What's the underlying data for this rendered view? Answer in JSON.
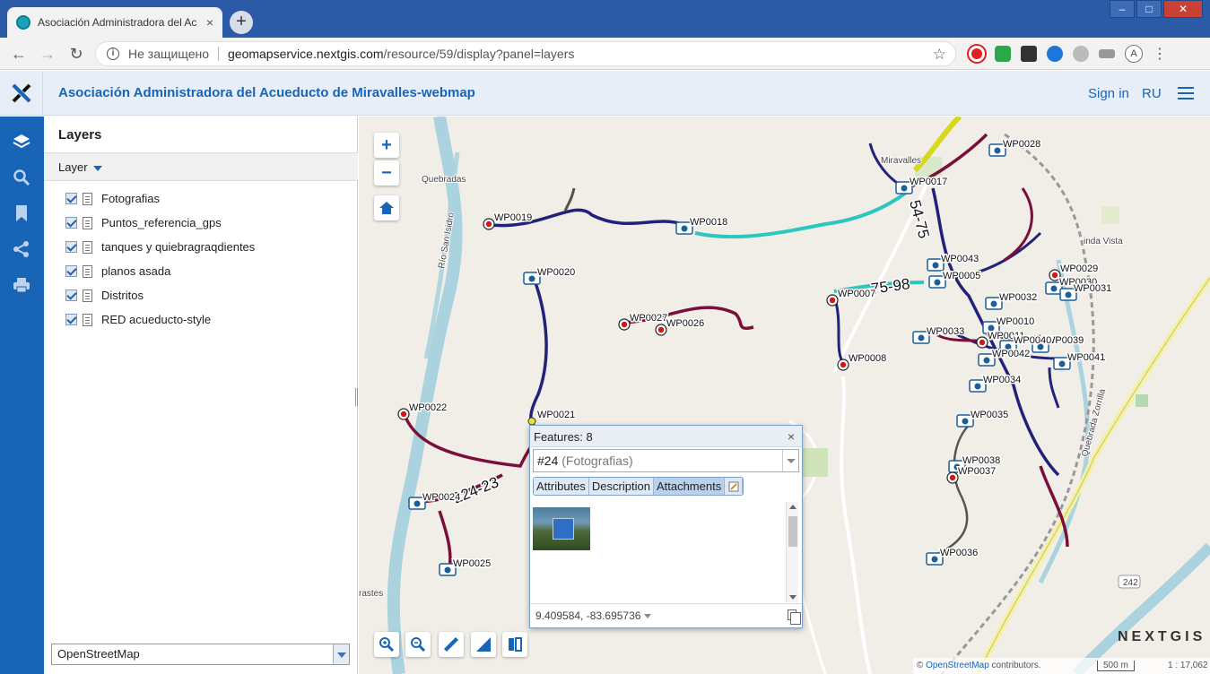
{
  "browser": {
    "tab_title": "Asociación Administradora del Ac",
    "tab_close": "×",
    "new_tab": "+",
    "insecure_label": "Не защищено",
    "url_host": "geomapservice.nextgis.com",
    "url_path": "/resource/59/display?panel=layers",
    "avatar_letter": "A"
  },
  "header": {
    "title": "Asociación Administradora del Acueducto de Miravalles-webmap",
    "signin": "Sign in",
    "lang": "RU"
  },
  "panel": {
    "title": "Layers",
    "sub_label": "Layer",
    "layers": [
      {
        "label": "Fotografias",
        "checked": true
      },
      {
        "label": "Puntos_referencia_gps",
        "checked": true
      },
      {
        "label": "tanques y quiebragraqdientes",
        "checked": true
      },
      {
        "label": "planos asada",
        "checked": true
      },
      {
        "label": "Distritos",
        "checked": true
      },
      {
        "label": "RED acueducto-style",
        "checked": true
      }
    ],
    "basemap": "OpenStreetMap"
  },
  "map": {
    "zoom_in": "+",
    "zoom_out": "−",
    "places": [
      "Quebradas",
      "Miravalles",
      "Río San Isidro",
      "inda Vista",
      "rastes",
      "Quebrada Zorrilla",
      "242"
    ],
    "segment_labels": [
      "54-75",
      "75-98",
      "224-23"
    ],
    "waypoints": [
      "WP0028",
      "WP0017",
      "WP0019",
      "WP0018",
      "WP0043",
      "WP0005",
      "WP0029",
      "WP0020",
      "WP0007",
      "WP0030",
      "WP0031",
      "WP0027",
      "WP0026",
      "WP0032",
      "WP0010",
      "WP0033",
      "WP0011",
      "WP0039",
      "WP0040",
      "WP0041",
      "WP0042",
      "WP0008",
      "WP0034",
      "WP0022",
      "WP0021",
      "WP0035",
      "WP0038",
      "WP0037",
      "WP0024",
      "WP0025",
      "WP0036"
    ],
    "logo": "NEXTGIS",
    "attribution_link": "OpenStreetMap",
    "attribution_text": "contributors.",
    "scale_bar": "500 m",
    "scale_ratio": "1 : 17,062"
  },
  "popup": {
    "header": "Features: 8",
    "feature_id": "#24",
    "feature_layer": "(Fotografias)",
    "tabs": [
      "Attributes",
      "Description",
      "Attachments"
    ],
    "active_tab": "Attachments",
    "coordinates": "9.409584, -83.695736"
  },
  "colors": {
    "chrome_blue": "#2b5ba7",
    "brand_blue": "#1865b8",
    "pipe_navy": "#22227a",
    "pipe_maroon": "#7a1038",
    "pipe_cyan": "#2cc6c0",
    "pipe_yellow": "#d8d81a",
    "river": "#aad3df"
  }
}
